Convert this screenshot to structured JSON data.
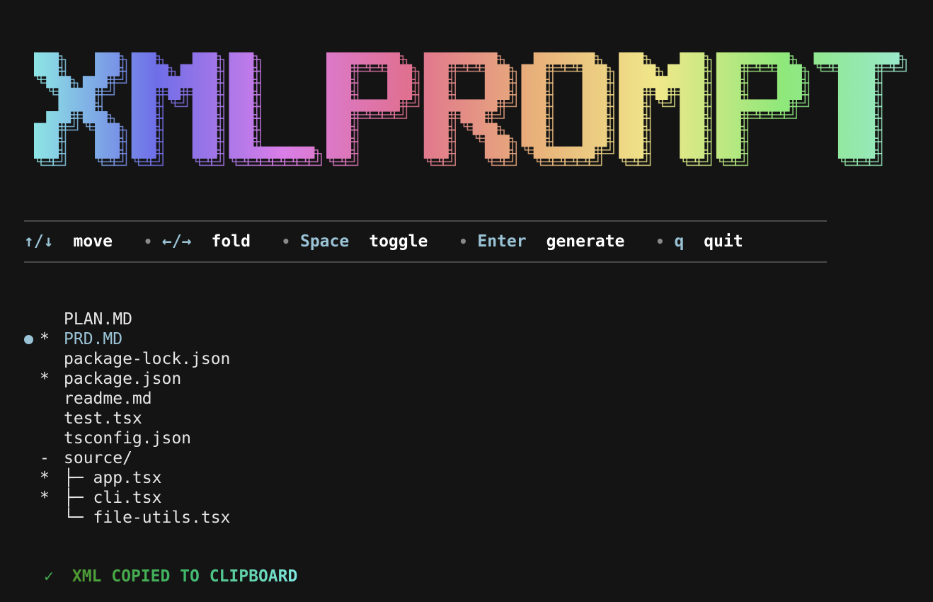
{
  "logo": {
    "text": "XMLPROMPT",
    "gradient": [
      "#8ee8e4",
      "#6f6ee8",
      "#d97ee8",
      "#e07090",
      "#e8b07a",
      "#f0e88a",
      "#8ee87a",
      "#9ae8d0"
    ]
  },
  "hints": [
    {
      "key": "↑/↓",
      "action": "move",
      "key_color": "#9ac3d6"
    },
    {
      "key": "←/→",
      "action": "fold",
      "key_color": "#9ac3d6"
    },
    {
      "key": "Space",
      "action": "toggle",
      "key_color": "#9ac3d6"
    },
    {
      "key": "Enter",
      "action": "generate",
      "key_color": "#9ac3d6"
    },
    {
      "key": "q",
      "action": "quit",
      "key_color": "#9ac3d6"
    }
  ],
  "hint_separator": "•",
  "tree": [
    {
      "mark": "",
      "prefix": "",
      "name": "PLAN.MD"
    },
    {
      "mark": "*",
      "prefix": "",
      "name": "PRD.MD",
      "cursor": true
    },
    {
      "mark": "",
      "prefix": "",
      "name": "package-lock.json"
    },
    {
      "mark": "*",
      "prefix": "",
      "name": "package.json"
    },
    {
      "mark": "",
      "prefix": "",
      "name": "readme.md"
    },
    {
      "mark": "",
      "prefix": "",
      "name": "test.tsx"
    },
    {
      "mark": "",
      "prefix": "",
      "name": "tsconfig.json"
    },
    {
      "mark": "-",
      "prefix": "",
      "name": "source/"
    },
    {
      "mark": "*",
      "prefix": "├─ ",
      "name": "app.tsx"
    },
    {
      "mark": "*",
      "prefix": "├─ ",
      "name": "cli.tsx"
    },
    {
      "mark": "",
      "prefix": "└─ ",
      "name": "file-utils.tsx"
    }
  ],
  "status": {
    "icon": "✓",
    "message": "XML COPIED TO CLIPBOARD"
  },
  "colors": {
    "background": "#141414",
    "accent": "#9ac3d6",
    "success": "#3ea64a"
  }
}
